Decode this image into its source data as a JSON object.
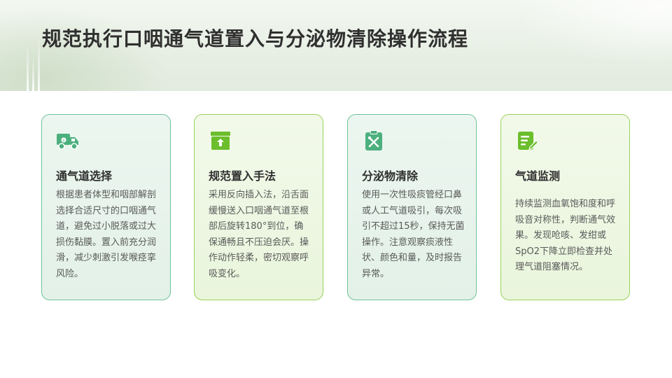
{
  "slide": {
    "title": "规范执行口咽通气道置入与分泌物清除操作流程"
  },
  "cards": [
    {
      "icon": "truck-icon",
      "heading": "通气道选择",
      "body": "根据患者体型和咽部解剖选择合适尺寸的口咽通气道，避免过小脱落或过大损伤黏膜。置入前充分润滑，减少刺激引发喉痉挛风险。"
    },
    {
      "icon": "box-upload-icon",
      "heading": "规范置入手法",
      "body": "采用反向插入法，沿舌面缓慢送入口咽通气道至根部后旋转180°到位，确保通畅且不压迫会厌。操作动作轻柔，密切观察呼吸变化。"
    },
    {
      "icon": "tools-icon",
      "heading": "分泌物清除",
      "body": "使用一次性吸痰管经口鼻或人工气道吸引，每次吸引不超过15秒，保持无菌操作。注意观察痰液性状、颜色和量，及时报告异常。"
    },
    {
      "icon": "document-edit-icon",
      "heading": "气道监测",
      "body": "持续监测血氧饱和度和呼吸音对称性，判断通气效果。发现呛咳、发绀或SpO2下降立即检查并处理气道阻塞情况。"
    }
  ],
  "colors": {
    "teal_icon": "#4cb07e",
    "green_icon": "#6cbe2c",
    "title": "#2f2f2f",
    "body_text": "#5a5a5a"
  }
}
